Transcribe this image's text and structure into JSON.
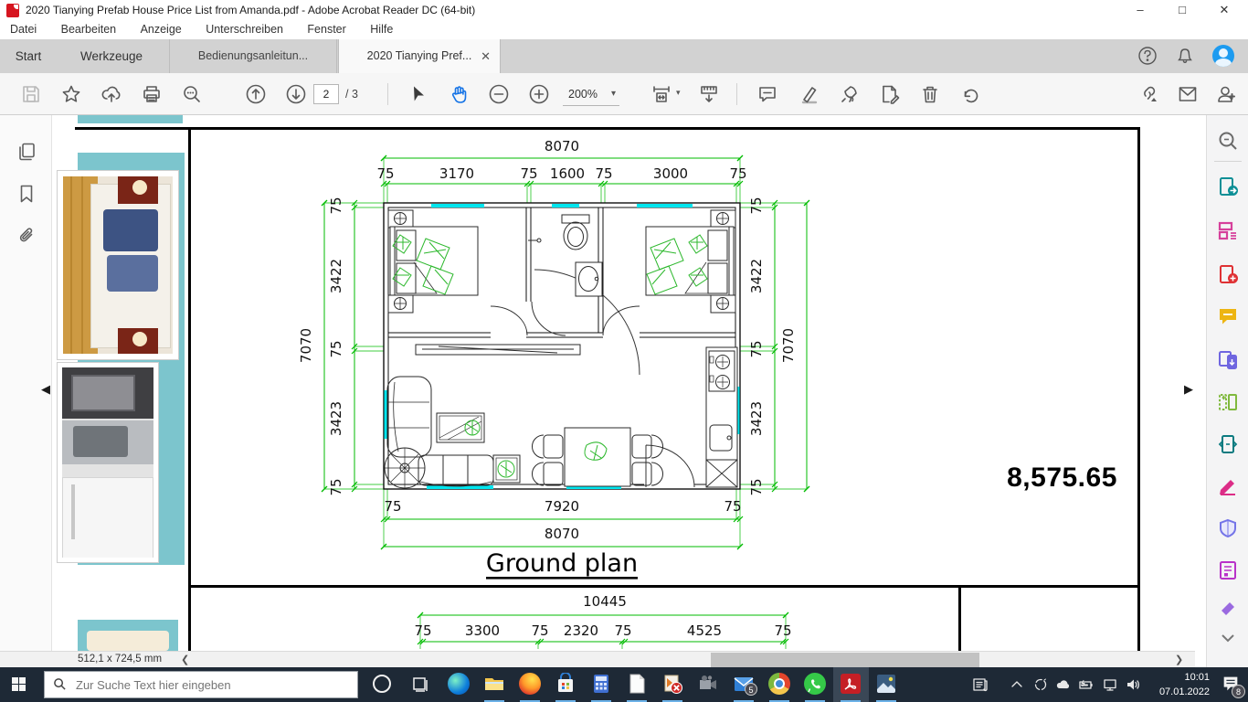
{
  "window": {
    "title": "2020 Tianying Prefab House Price List from Amanda.pdf - Adobe Acrobat Reader DC (64-bit)"
  },
  "menu": {
    "items": [
      "Datei",
      "Bearbeiten",
      "Anzeige",
      "Unterschreiben",
      "Fenster",
      "Hilfe"
    ]
  },
  "tabs": {
    "start": "Start",
    "tools": "Werkzeuge",
    "documents": [
      {
        "label": "Bedienungsanleitun..."
      },
      {
        "label": "2020 Tianying Pref...",
        "active": true
      }
    ]
  },
  "toolbar": {
    "page_current": "2",
    "page_total": "/ 3",
    "zoom_value": "200%"
  },
  "doc": {
    "price": "8,575.65",
    "plan": {
      "title": "Ground plan",
      "top_total": "8070",
      "top_segments": [
        "75",
        "3170",
        "75",
        "1600",
        "75",
        "3000",
        "75"
      ],
      "left_outer": "7070",
      "left_segments": [
        "75",
        "3422",
        "75",
        "3423",
        "75"
      ],
      "right_outer": "7070",
      "right_segments": [
        "75",
        "3422",
        "75",
        "3423",
        "75"
      ],
      "bottom_segments": [
        "75",
        "7920",
        "75"
      ],
      "bottom_total": "8070",
      "lower_total": "10445",
      "lower_segments": [
        "75",
        "3300",
        "75",
        "2320",
        "75",
        "4525",
        "75"
      ]
    },
    "colors": {
      "dimension_green": "#00bb00",
      "window_cyan": "#00e5ee",
      "photo_teal": "#7cc5cd"
    }
  },
  "statusbar": {
    "page_size": "512,1 x 724,5 mm"
  },
  "taskbar": {
    "search_placeholder": "Zur Suche Text hier eingeben",
    "mail_badge": "5",
    "notification_badge": "8",
    "clock_time": "10:01",
    "clock_date": "07.01.2022"
  }
}
